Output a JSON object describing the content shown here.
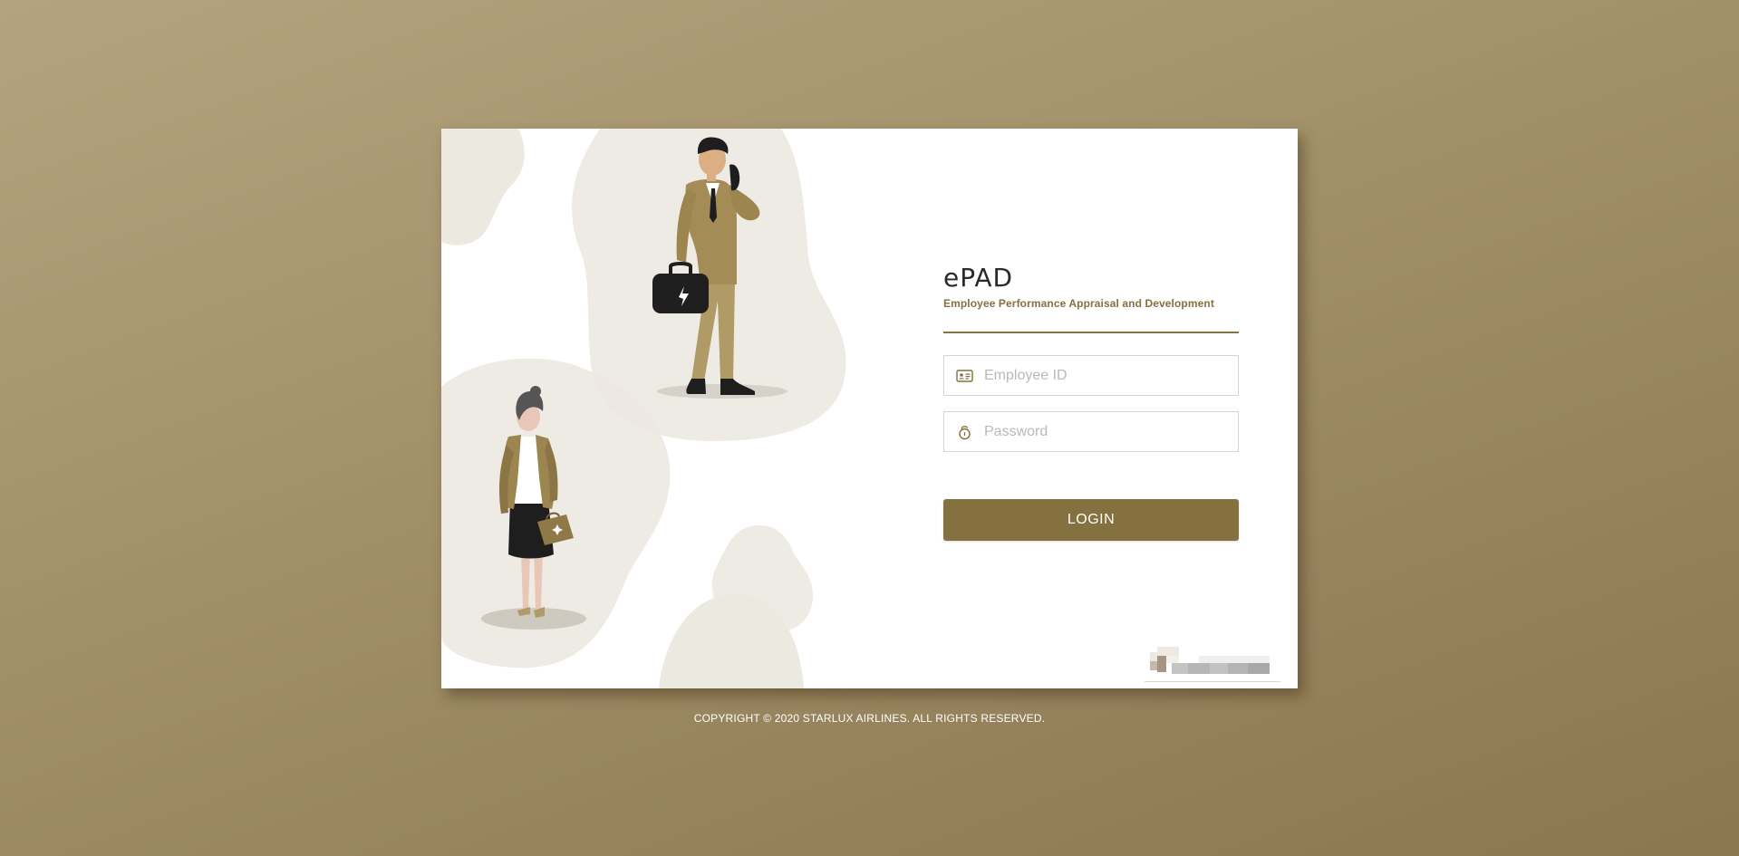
{
  "app": {
    "logo_text": "ePAD",
    "subtitle": "Employee Performance Appraisal and Development"
  },
  "form": {
    "employee_id": {
      "placeholder": "Employee ID",
      "value": "",
      "icon": "id-card-icon"
    },
    "password": {
      "placeholder": "Password",
      "value": "",
      "icon": "lock-icon"
    },
    "login_label": "LOGIN"
  },
  "footer": {
    "copyright": "COPYRIGHT © 2020 STARLUX AIRLINES. ALL RIGHTS RESERVED."
  },
  "colors": {
    "accent": "#85703f",
    "background_light": "#b3a47f",
    "background_dark": "#8a7650",
    "blob": "#ece9e1"
  }
}
